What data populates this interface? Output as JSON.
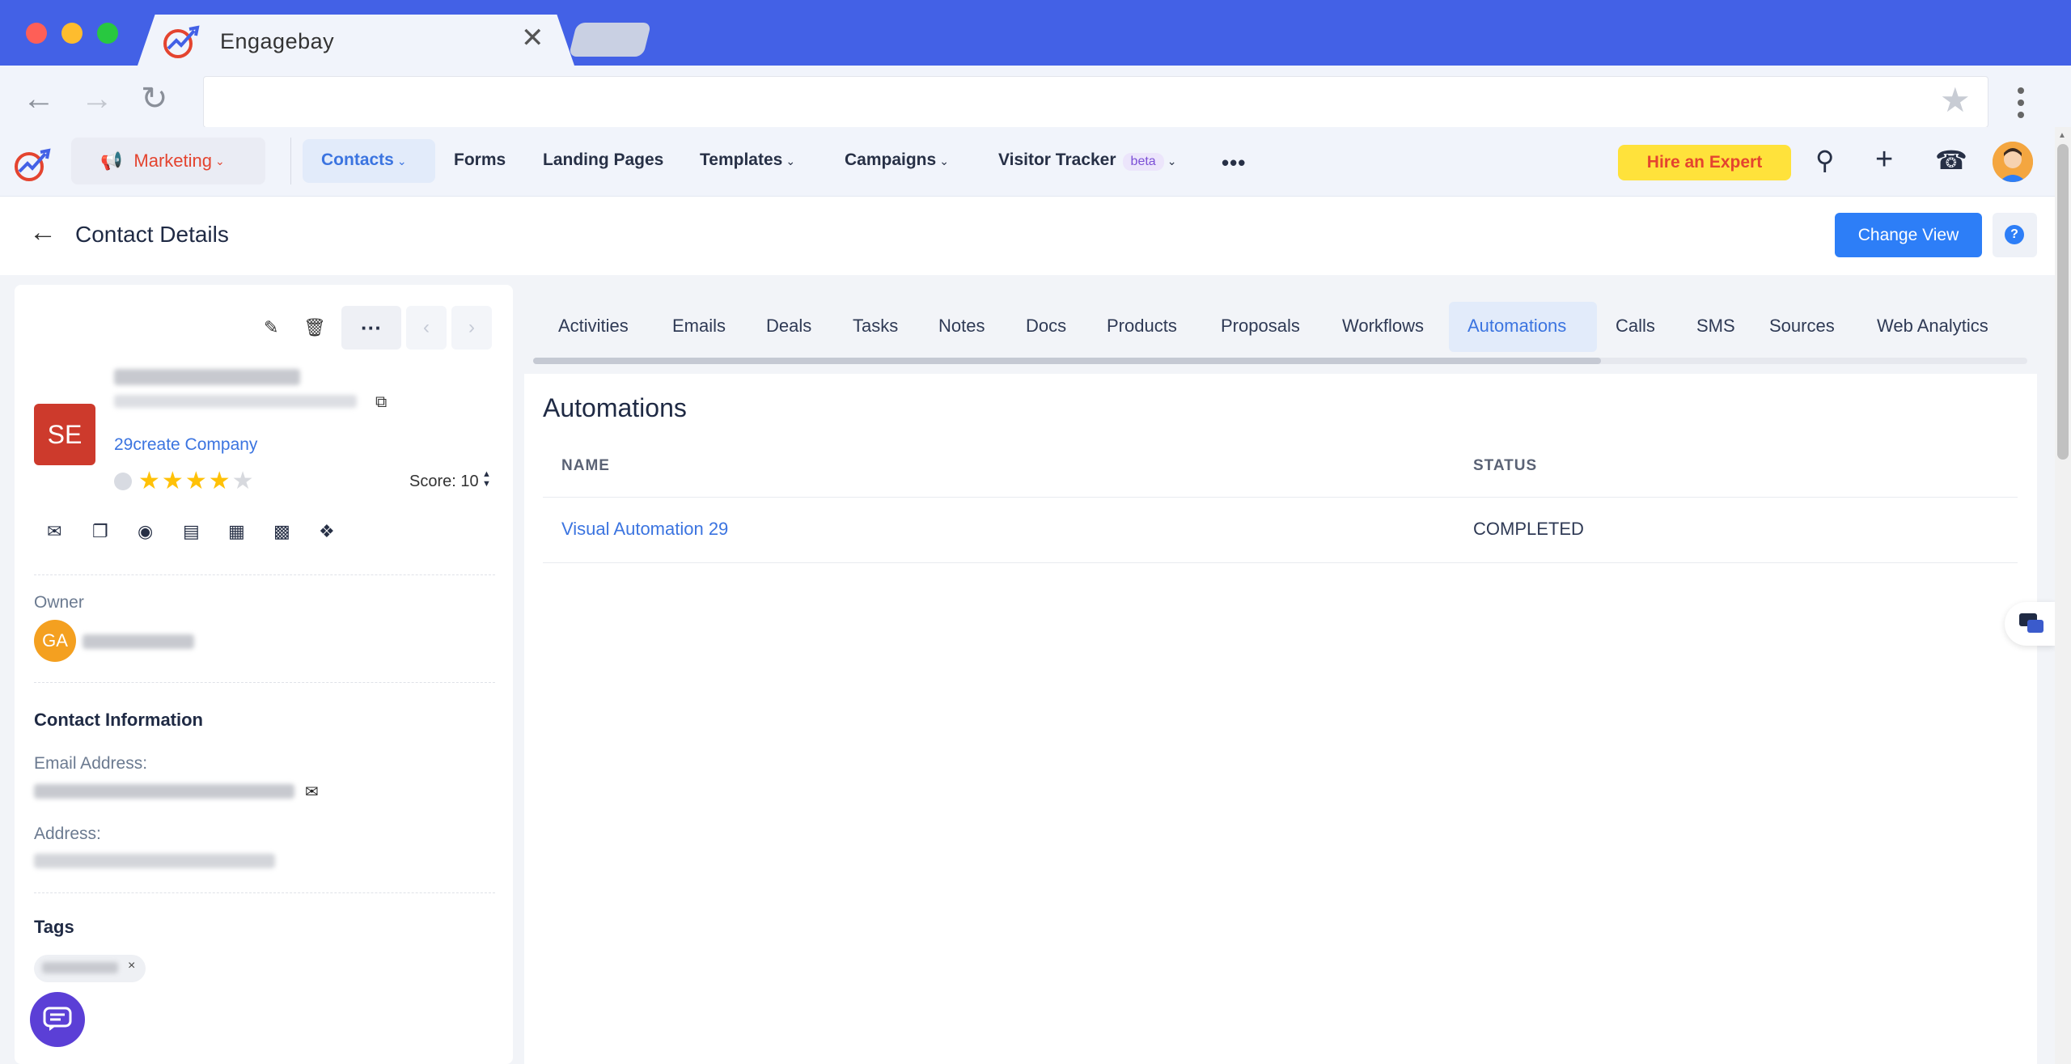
{
  "browser": {
    "tab_title": "Engagebay",
    "tab_close": "✕",
    "url": ""
  },
  "header": {
    "module": "Marketing",
    "nav": [
      {
        "label": "Contacts"
      },
      {
        "label": "Forms"
      },
      {
        "label": "Landing Pages"
      },
      {
        "label": "Templates"
      },
      {
        "label": "Campaigns"
      },
      {
        "label": "Visitor Tracker",
        "badge": "beta"
      }
    ],
    "more": "•••",
    "hire_expert": "Hire an Expert"
  },
  "page": {
    "title": "Contact Details",
    "change_view": "Change View",
    "help": "?"
  },
  "contact": {
    "initials": "SE",
    "company": "29create Company",
    "rating": 4,
    "rating_max": 5,
    "score_label": "Score: 10",
    "owner_label": "Owner",
    "owner_initials": "GA",
    "contact_info_heading": "Contact Information",
    "email_label": "Email Address:",
    "address_label": "Address:",
    "tags_heading": "Tags"
  },
  "tabs": [
    {
      "label": "Activities"
    },
    {
      "label": "Emails"
    },
    {
      "label": "Deals"
    },
    {
      "label": "Tasks"
    },
    {
      "label": "Notes"
    },
    {
      "label": "Docs"
    },
    {
      "label": "Products"
    },
    {
      "label": "Proposals"
    },
    {
      "label": "Workflows"
    },
    {
      "label": "Automations"
    },
    {
      "label": "Calls"
    },
    {
      "label": "SMS"
    },
    {
      "label": "Sources"
    },
    {
      "label": "Web Analytics"
    }
  ],
  "automations": {
    "title": "Automations",
    "columns": [
      "NAME",
      "STATUS"
    ],
    "rows": [
      {
        "name": "Visual Automation 29",
        "status": "COMPLETED"
      }
    ]
  },
  "colors": {
    "titlebar": "#4361e6",
    "accent": "#2d7ef7",
    "link": "#3b74e0",
    "brand_red": "#e4442f",
    "hire_bg": "#ffe23b"
  }
}
